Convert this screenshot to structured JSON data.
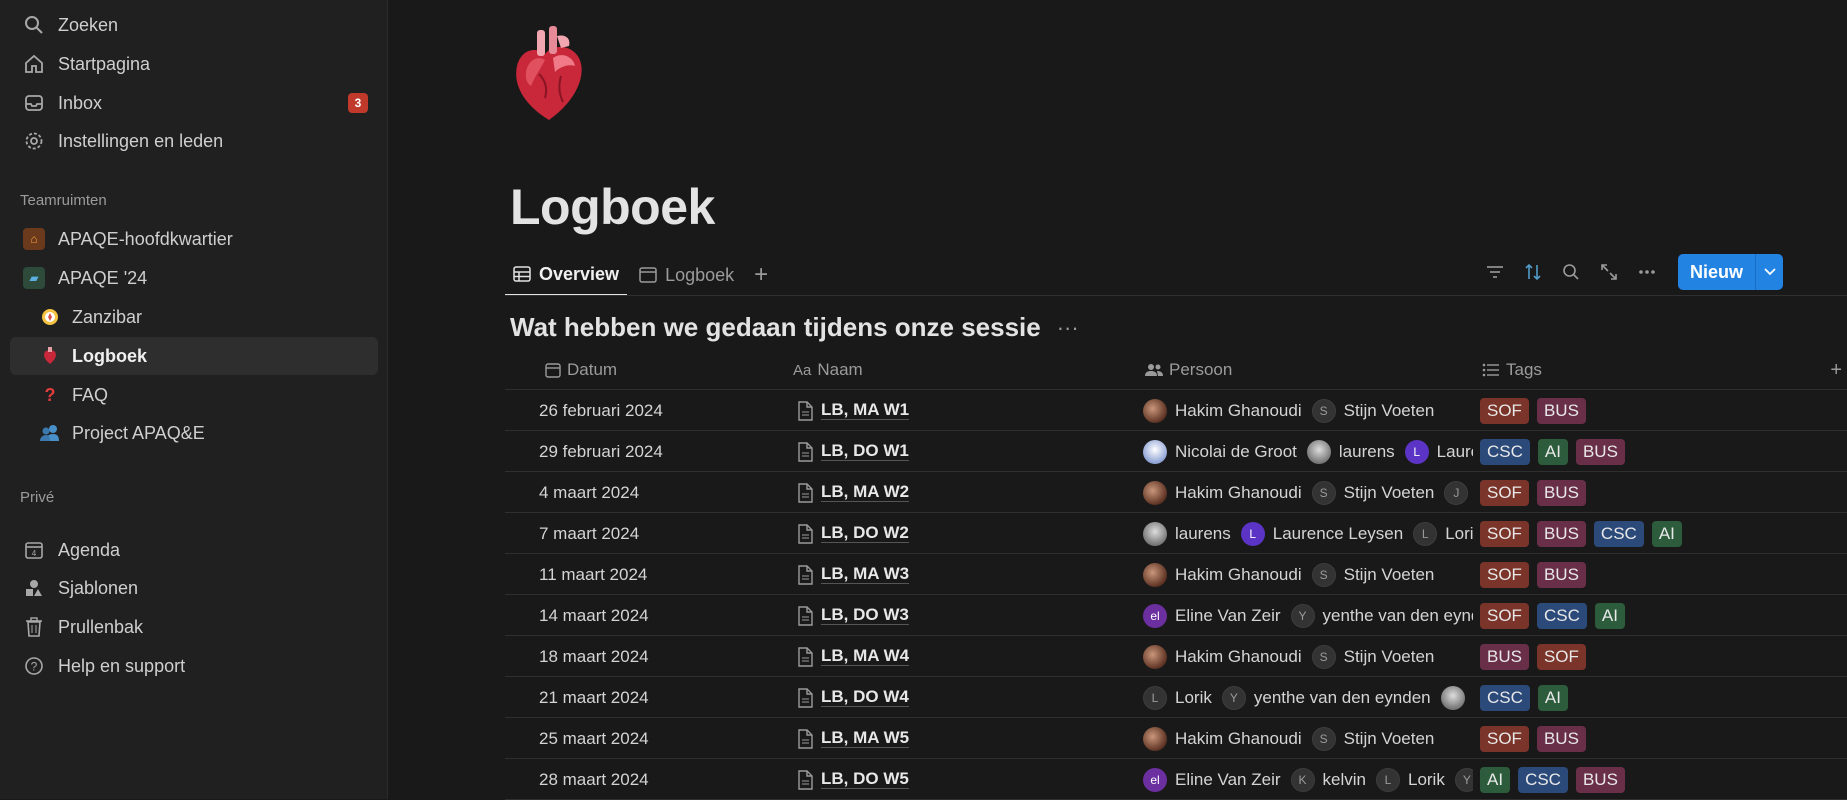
{
  "sidebar": {
    "top": [
      {
        "label": "Zoeken",
        "icon": "search-icon"
      },
      {
        "label": "Startpagina",
        "icon": "home-icon"
      },
      {
        "label": "Inbox",
        "icon": "inbox-icon",
        "badge": "3"
      },
      {
        "label": "Instellingen en leden",
        "icon": "gear-icon"
      }
    ],
    "teamspaces_label": "Teamruimten",
    "teams": [
      {
        "label": "APAQE-hoofdkwartier",
        "icon": "house-emoji-icon"
      },
      {
        "label": "APAQE '24",
        "icon": "flag-icon"
      },
      {
        "label": "Zanzibar",
        "icon": "compass-icon"
      },
      {
        "label": "Logboek",
        "icon": "heart-icon"
      },
      {
        "label": "FAQ",
        "icon": "question-icon"
      },
      {
        "label": "Project APAQ&E",
        "icon": "people-icon"
      }
    ],
    "private_label": "Privé",
    "bottom": [
      {
        "label": "Agenda",
        "icon": "calendar-icon"
      },
      {
        "label": "Sjablonen",
        "icon": "shapes-icon"
      },
      {
        "label": "Prullenbak",
        "icon": "trash-icon"
      },
      {
        "label": "Help en support",
        "icon": "help-icon"
      }
    ]
  },
  "page": {
    "title": "Logboek",
    "icon": "anatomical-heart-icon",
    "tabs": [
      {
        "label": "Overview",
        "icon": "table-icon"
      },
      {
        "label": "Logboek",
        "icon": "calendar-icon"
      }
    ],
    "new_button": "Nieuw",
    "db_title": "Wat hebben we gedaan tijdens onze sessie"
  },
  "table": {
    "columns": [
      {
        "label": "Datum",
        "icon": "calendar-icon"
      },
      {
        "label": "Naam",
        "icon": "text-icon",
        "prefix": "Aa"
      },
      {
        "label": "Persoon",
        "icon": "people-icon"
      },
      {
        "label": "Tags",
        "icon": "list-icon"
      }
    ],
    "rows": [
      {
        "date": "26 februari 2024",
        "name": "LB, MA W1",
        "people": [
          {
            "name": "Hakim Ghanoudi",
            "avatar": "photo"
          },
          {
            "name": "Stijn Voeten",
            "avatar": "letter",
            "initial": "S"
          }
        ],
        "tags": [
          "SOF",
          "BUS"
        ]
      },
      {
        "date": "29 februari 2024",
        "name": "LB, DO W1",
        "people": [
          {
            "name": "Nicolai de Groot",
            "avatar": "blue"
          },
          {
            "name": "laurens",
            "avatar": "grey"
          },
          {
            "name": "Laurence Leysen",
            "avatar": "violet",
            "initial": "L"
          }
        ],
        "tags": [
          "CSC",
          "AI",
          "BUS"
        ]
      },
      {
        "date": "4 maart 2024",
        "name": "LB, MA W2",
        "people": [
          {
            "name": "Hakim Ghanoudi",
            "avatar": "photo"
          },
          {
            "name": "Stijn Voeten",
            "avatar": "letter",
            "initial": "S"
          },
          {
            "name": "",
            "avatar": "letter",
            "initial": "J"
          }
        ],
        "tags": [
          "SOF",
          "BUS"
        ]
      },
      {
        "date": "7 maart 2024",
        "name": "LB, DO W2",
        "people": [
          {
            "name": "laurens",
            "avatar": "grey"
          },
          {
            "name": "Laurence Leysen",
            "avatar": "violet",
            "initial": "L"
          },
          {
            "name": "Lorik",
            "avatar": "letter",
            "initial": "L"
          }
        ],
        "tags": [
          "SOF",
          "BUS",
          "CSC",
          "AI"
        ]
      },
      {
        "date": "11 maart 2024",
        "name": "LB, MA W3",
        "people": [
          {
            "name": "Hakim Ghanoudi",
            "avatar": "photo"
          },
          {
            "name": "Stijn Voeten",
            "avatar": "letter",
            "initial": "S"
          }
        ],
        "tags": [
          "SOF",
          "BUS"
        ]
      },
      {
        "date": "14 maart 2024",
        "name": "LB, DO W3",
        "people": [
          {
            "name": "Eline Van Zeir",
            "avatar": "purple",
            "initial": "el"
          },
          {
            "name": "yenthe van den eynden",
            "avatar": "letter",
            "initial": "Y"
          }
        ],
        "tags": [
          "SOF",
          "CSC",
          "AI"
        ]
      },
      {
        "date": "18 maart 2024",
        "name": "LB, MA W4",
        "people": [
          {
            "name": "Hakim Ghanoudi",
            "avatar": "photo"
          },
          {
            "name": "Stijn Voeten",
            "avatar": "letter",
            "initial": "S"
          }
        ],
        "tags": [
          "BUS",
          "SOF"
        ]
      },
      {
        "date": "21 maart 2024",
        "name": "LB, DO W4",
        "people": [
          {
            "name": "Lorik",
            "avatar": "letter",
            "initial": "L"
          },
          {
            "name": "yenthe van den eynden",
            "avatar": "letter",
            "initial": "Y"
          },
          {
            "name": "",
            "avatar": "grey"
          }
        ],
        "tags": [
          "CSC",
          "AI"
        ]
      },
      {
        "date": "25 maart 2024",
        "name": "LB, MA W5",
        "people": [
          {
            "name": "Hakim Ghanoudi",
            "avatar": "photo"
          },
          {
            "name": "Stijn Voeten",
            "avatar": "letter",
            "initial": "S"
          }
        ],
        "tags": [
          "SOF",
          "BUS"
        ]
      },
      {
        "date": "28 maart 2024",
        "name": "LB, DO W5",
        "people": [
          {
            "name": "Eline Van Zeir",
            "avatar": "purple",
            "initial": "el"
          },
          {
            "name": "kelvin",
            "avatar": "letter",
            "initial": "K"
          },
          {
            "name": "Lorik",
            "avatar": "letter",
            "initial": "L"
          },
          {
            "name": "",
            "avatar": "letter",
            "initial": "Y"
          }
        ],
        "tags": [
          "AI",
          "CSC",
          "BUS"
        ]
      }
    ]
  },
  "colors": {
    "accent": "#2383e2",
    "badge": "#c0392b",
    "SOF": "#7a3429",
    "BUS": "#6a2f48",
    "CSC": "#2b4a7a",
    "AI": "#2c5c3c"
  }
}
